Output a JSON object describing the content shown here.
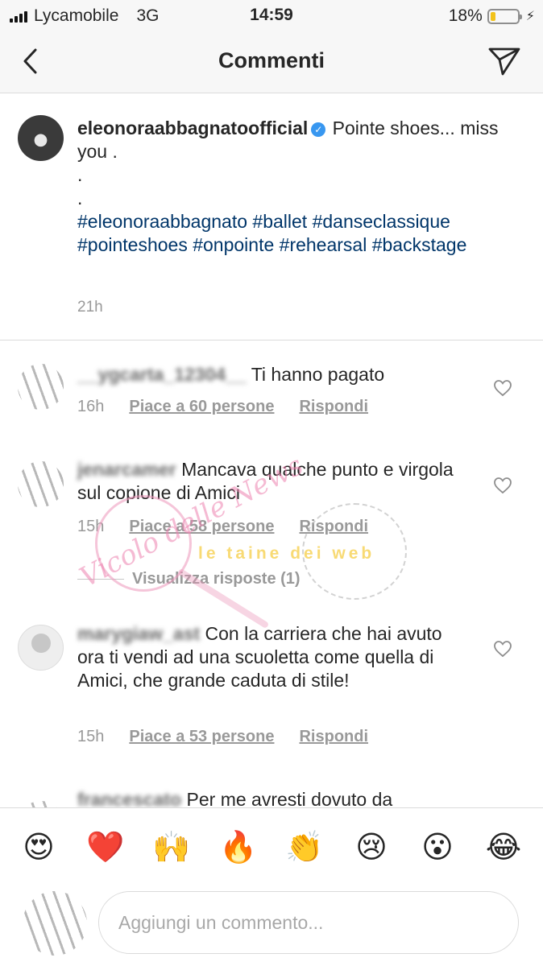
{
  "status_bar": {
    "carrier": "Lycamobile",
    "network": "3G",
    "time": "14:59",
    "battery_percent": "18%",
    "battery_level": 0.18
  },
  "header": {
    "title": "Commenti",
    "back_icon": "chevron-left-icon",
    "share_icon": "paper-plane-icon"
  },
  "caption": {
    "username": "eleonoraabbagnatoofficial",
    "text": "Pointe shoes... miss you .",
    "dot_lines": [
      ".",
      "."
    ],
    "hashtags": "#eleonoraabbagnato #ballet #danseclassique #pointeshoes #onpointe #rehearsal #backstage",
    "time": "21h"
  },
  "comments": [
    {
      "username": "__ygcarta_12304__",
      "text": "Ti hanno pagato",
      "time": "16h",
      "likes": "Piace a 60 persone",
      "reply": "Rispondi"
    },
    {
      "username": "jenarcamer",
      "text": "Mancava qualche punto e virgola sul copione di Amici",
      "time": "15h",
      "likes": "Piace a 58 persone",
      "reply": "Rispondi",
      "view_replies": "Visualizza risposte (1)"
    },
    {
      "username": "marygiaw_ast",
      "text": "Con la carriera che hai avuto ora ti vendi ad una scuoletta come quella di Amici, che grande caduta di stile!",
      "time": "15h",
      "likes": "Piace a 53 persone",
      "reply": "Rispondi"
    },
    {
      "username": "francescato",
      "text": "Per me avresti dovuto da"
    }
  ],
  "watermark": {
    "script_text": "Vicolo delle News",
    "band_text": "le taine dei web"
  },
  "emojis": [
    "😍",
    "❤️",
    "🙌",
    "🔥",
    "👏",
    "😢",
    "😮",
    "😂"
  ],
  "composer": {
    "placeholder": "Aggiungi un commento..."
  },
  "colors": {
    "hashtag": "#003569",
    "verified": "#3897f0",
    "battery": "#f2c21a",
    "meta": "#999999"
  }
}
